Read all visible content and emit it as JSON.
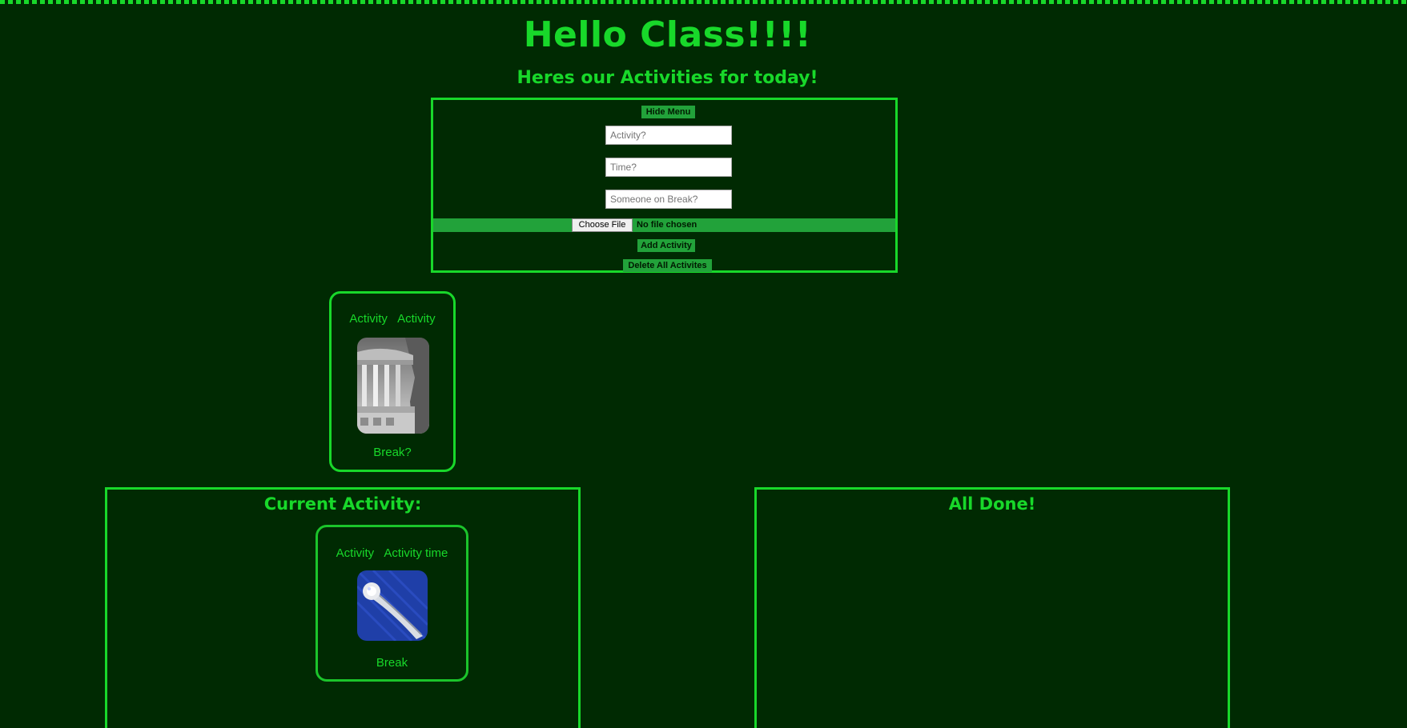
{
  "header": {
    "title": "Hello Class!!!!",
    "subtitle": "Heres our Activities for today!"
  },
  "menu": {
    "hide_label": "Hide Menu",
    "activity_placeholder": "Activity?",
    "time_placeholder": "Time?",
    "break_placeholder": "Someone on Break?",
    "choose_file_label": "Choose File",
    "file_status": "No file chosen",
    "add_label": "Add Activity",
    "delete_label": "Delete All Activites"
  },
  "activity_card": {
    "name": "Activity",
    "time": "Activity",
    "break": "Break?",
    "image": "temple-ruins-photo"
  },
  "current": {
    "title": "Current Activity:",
    "card": {
      "name": "Activity",
      "time": "Activity time",
      "break": "Break",
      "image": "diamond-ring-photo"
    }
  },
  "done": {
    "title": "All Done!"
  },
  "colors": {
    "background": "#002a02",
    "accent": "#18d82a",
    "button": "#22a23a"
  }
}
